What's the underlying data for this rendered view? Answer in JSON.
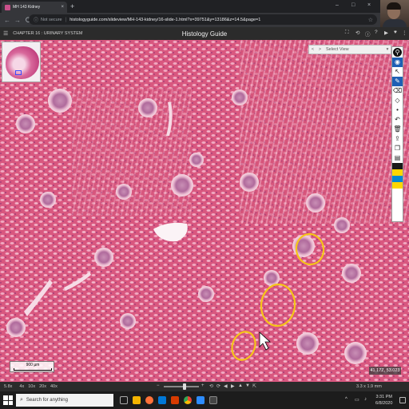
{
  "browser": {
    "tab_title": "MH 143 Kidney",
    "tab_close": "×",
    "new_tab": "+",
    "window_controls": [
      "–",
      "□",
      "×"
    ],
    "nav": {
      "back": "←",
      "forward": "→",
      "reload": "C"
    },
    "security_label": "Not secure",
    "url": "histologyguide.com/slideview/MH-143-kidney/16-slide-1.html?x=39751&y=13186&z=14.5&page=1"
  },
  "app_header": {
    "menu_glyph": "☰",
    "chapter": "CHAPTER 16 : URINARY SYSTEM",
    "brand": "Histology Guide",
    "right_icons": [
      "⛶",
      "⟲",
      "ⓘ",
      "?",
      "▶",
      "♥",
      "⋮"
    ]
  },
  "viewer": {
    "select_view": {
      "prev": "<",
      "next": ">",
      "label": "Select View",
      "dropdown": "▾"
    },
    "scale_label": "900 µm",
    "coordinates": "41.17Z, 53.023",
    "annotation_color": "#f5c518",
    "tools": [
      {
        "name": "marker",
        "glyph": "⚲"
      },
      {
        "name": "eye",
        "glyph": "◉"
      },
      {
        "name": "pointer",
        "glyph": "↖"
      },
      {
        "name": "pen",
        "glyph": "✎"
      },
      {
        "name": "eraser",
        "glyph": "⌫"
      },
      {
        "name": "tag",
        "glyph": "◇"
      },
      {
        "name": "dot",
        "glyph": "•"
      },
      {
        "name": "undo",
        "glyph": "↶"
      },
      {
        "name": "trash",
        "glyph": "🗑"
      },
      {
        "name": "upload",
        "glyph": "⇪"
      },
      {
        "name": "copy",
        "glyph": "❐"
      },
      {
        "name": "doc",
        "glyph": "▤"
      }
    ],
    "swatches": [
      "#1a1a1a",
      "#ffd600",
      "#0288d1",
      "#ffd600"
    ]
  },
  "view_bar": {
    "zoom_levels": [
      "5.8x",
      "4x",
      "10x",
      "20x",
      "40x"
    ],
    "controls": [
      "⟲",
      "⟳",
      "◀",
      "▶",
      "▲",
      "▼",
      "⇱"
    ],
    "dimensions": "3.3 x 1.9 mm"
  },
  "taskbar": {
    "search_placeholder": "Search for anything",
    "tray": [
      "^",
      "▭",
      "♪"
    ],
    "time": "3:31 PM",
    "date": "6/8/2020"
  }
}
